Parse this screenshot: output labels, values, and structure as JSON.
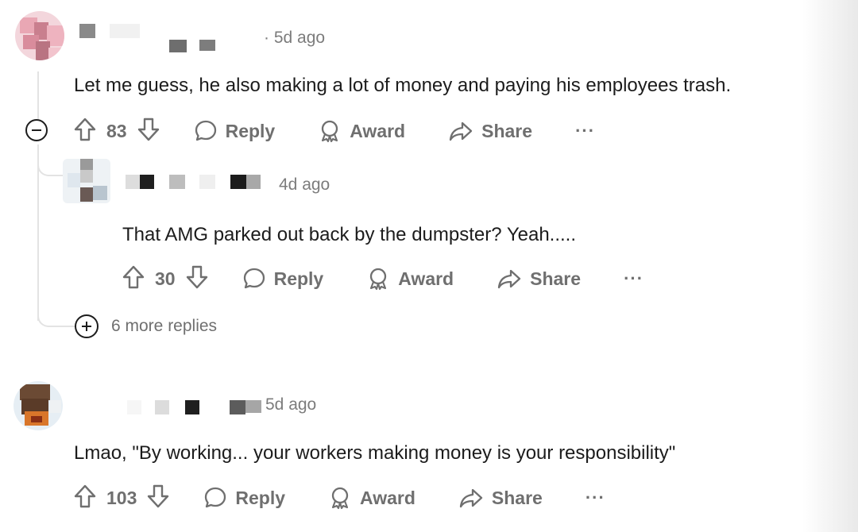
{
  "comments": [
    {
      "time": "· 5d ago",
      "text": "Let me guess, he also making a lot of money and paying his employees trash.",
      "votes": "83",
      "reply_label": "Reply",
      "award_label": "Award",
      "share_label": "Share",
      "more_label": "···"
    },
    {
      "time": "4d ago",
      "text": "That AMG parked out back by the dumpster? Yeah.....",
      "votes": "30",
      "reply_label": "Reply",
      "award_label": "Award",
      "share_label": "Share",
      "more_label": "···"
    },
    {
      "time": "5d ago",
      "text": "Lmao, \"By working... your workers making money is your responsibility\"",
      "votes": "103",
      "reply_label": "Reply",
      "award_label": "Award",
      "share_label": "Share",
      "more_label": "···"
    }
  ],
  "thread": {
    "more_replies_label": "6 more replies"
  },
  "colors": {
    "text": "#1c1c1c",
    "muted": "#7c7c7c",
    "action": "#6f6f6f",
    "thread_line": "#e3e3e3"
  }
}
